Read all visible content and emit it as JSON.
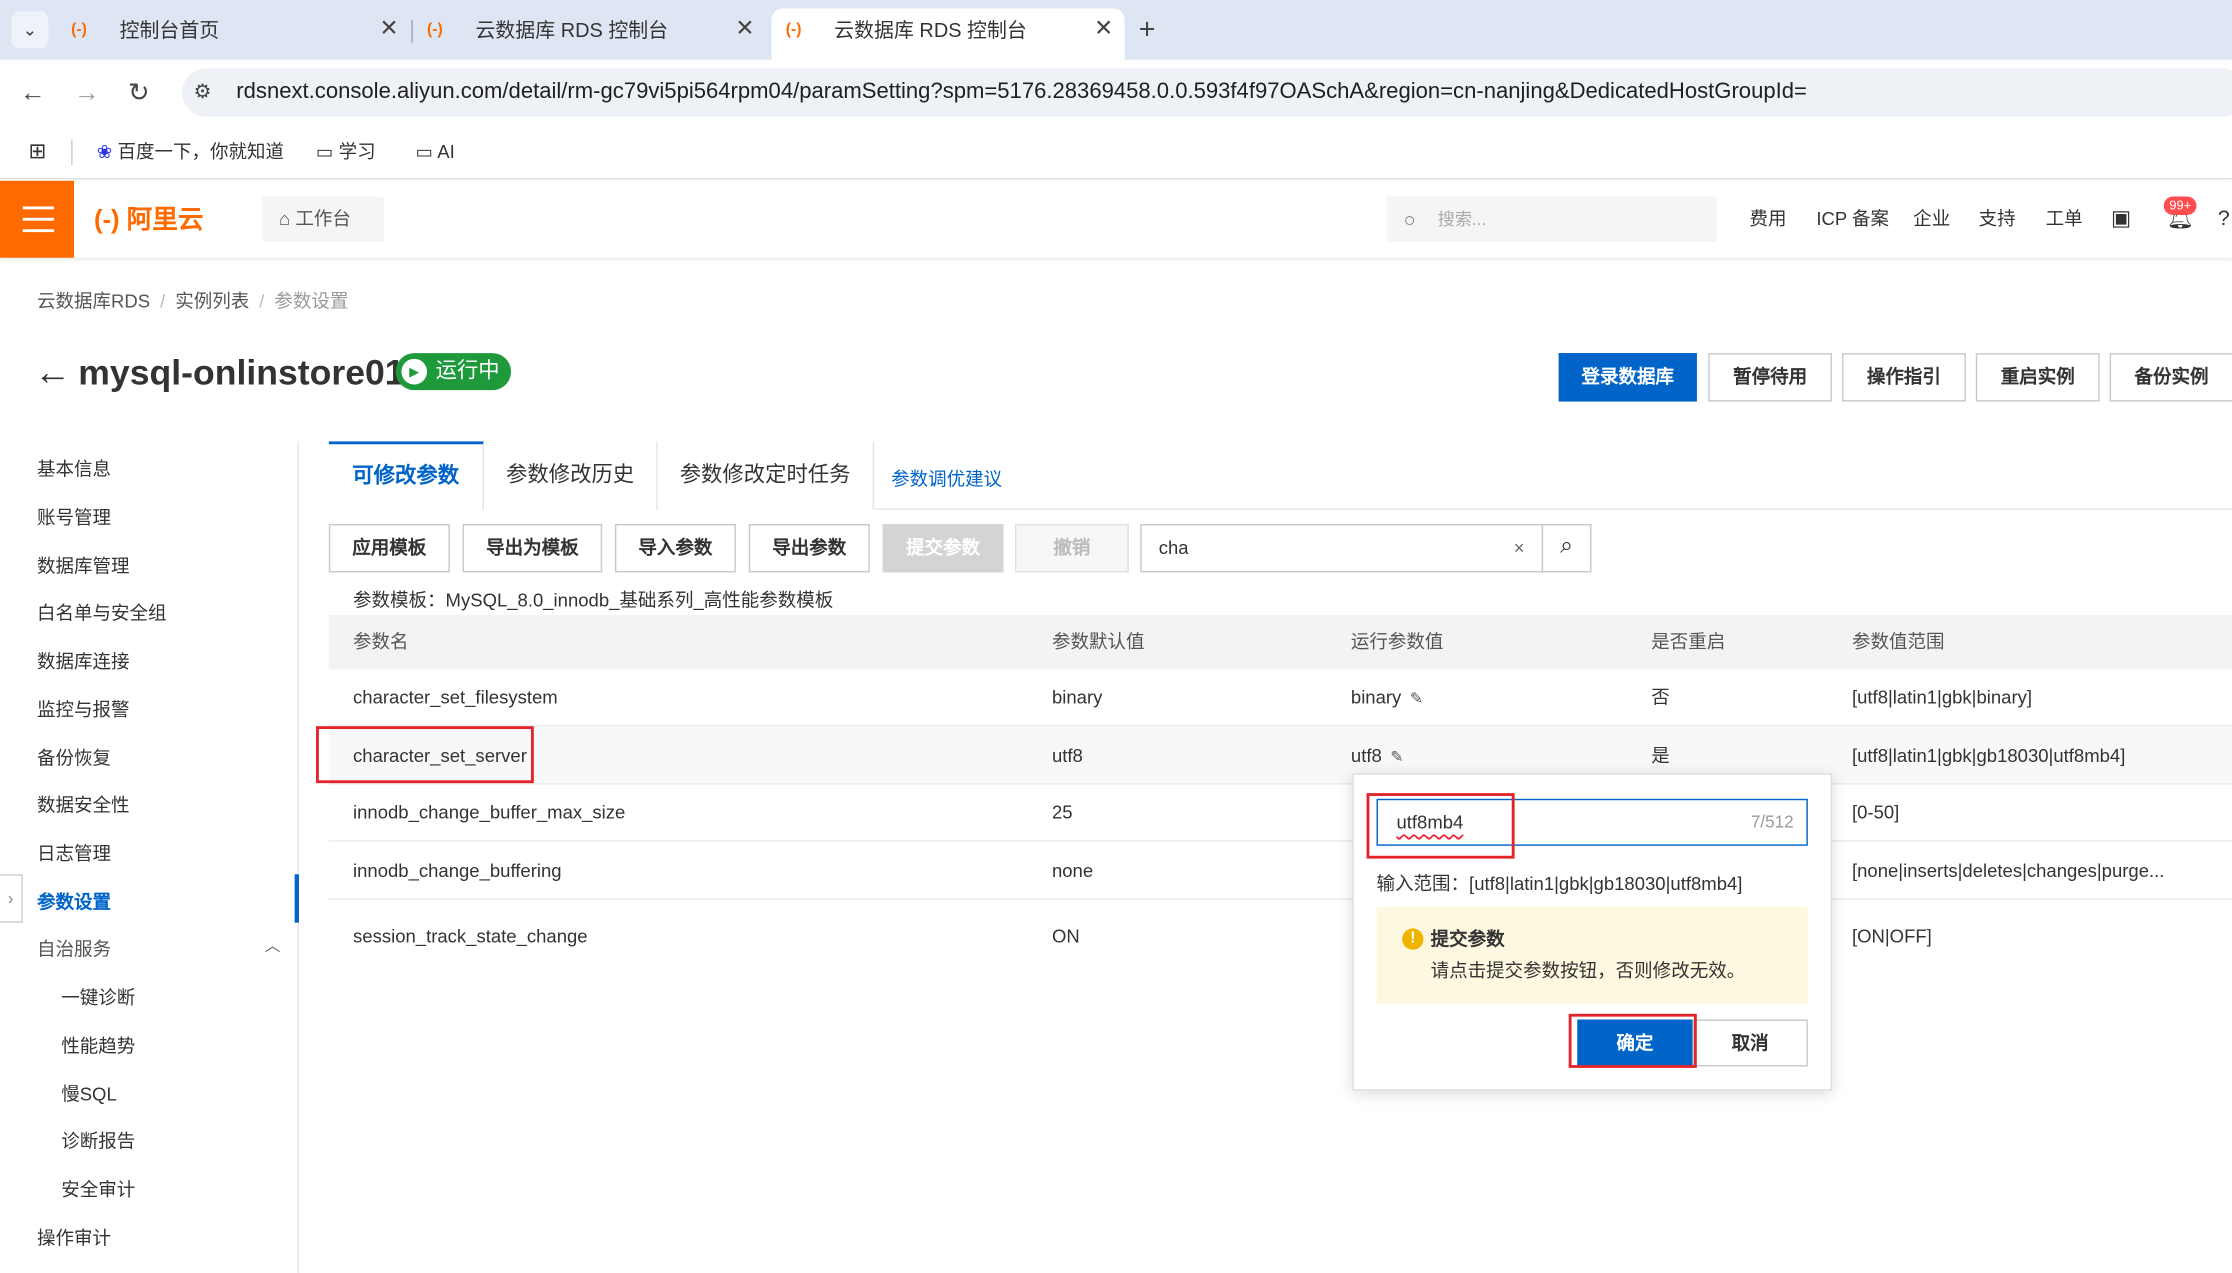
{
  "browser": {
    "tabs": [
      {
        "label": "控制台首页",
        "active": false
      },
      {
        "label": "云数据库 RDS 控制台",
        "active": false
      },
      {
        "label": "云数据库 RDS 控制台",
        "active": true
      }
    ],
    "url": "rdsnext.console.aliyun.com/detail/rm-gc79vi5pi564rpm04/paramSetting?spm=5176.28369458.0.0.593f4f97OASchA&region=cn-nanjing&DedicatedHostGroupId=",
    "bookmarks": [
      "百度一下，你就知道",
      "学习",
      "AI"
    ]
  },
  "header": {
    "logo": "(-) 阿里云",
    "workbench": "工作台",
    "search_placeholder": "搜索...",
    "nav": [
      "费用",
      "ICP 备案",
      "企业",
      "支持",
      "工单"
    ],
    "notification_badge": "99+",
    "accent_color": "#ff6a00"
  },
  "breadcrumb": [
    "云数据库RDS",
    "实例列表",
    "参数设置"
  ],
  "instance": {
    "name": "mysql-onlinstore01",
    "status": "运行中",
    "status_color": "#1f9a3a"
  },
  "actions": [
    "登录数据库",
    "暂停待用",
    "操作指引",
    "重启实例",
    "备份实例"
  ],
  "sidebar": {
    "items": [
      {
        "label": "基本信息"
      },
      {
        "label": "账号管理"
      },
      {
        "label": "数据库管理"
      },
      {
        "label": "白名单与安全组"
      },
      {
        "label": "数据库连接"
      },
      {
        "label": "监控与报警"
      },
      {
        "label": "备份恢复"
      },
      {
        "label": "数据安全性"
      },
      {
        "label": "日志管理"
      },
      {
        "label": "参数设置",
        "active": true
      },
      {
        "label": "自治服务"
      },
      {
        "label": "一键诊断",
        "sub": true
      },
      {
        "label": "性能趋势",
        "sub": true
      },
      {
        "label": "慢SQL",
        "sub": true
      },
      {
        "label": "诊断报告",
        "sub": true
      },
      {
        "label": "安全审计",
        "sub": true
      },
      {
        "label": "操作审计"
      }
    ]
  },
  "param_tabs": [
    "可修改参数",
    "参数修改历史",
    "参数修改定时任务"
  ],
  "param_tab_link": "参数调优建议",
  "toolbar": {
    "buttons": [
      "应用模板",
      "导出为模板",
      "导入参数",
      "导出参数",
      "提交参数",
      "撤销"
    ],
    "filter_value": "cha",
    "clear": "×"
  },
  "template_note": "参数模板：MySQL_8.0_innodb_基础系列_高性能参数模板",
  "table": {
    "columns": [
      "参数名",
      "参数默认值",
      "运行参数值",
      "是否重启",
      "参数值范围"
    ],
    "rows": [
      {
        "name": "character_set_filesystem",
        "default": "binary",
        "running": "binary",
        "restart": "否",
        "range": "[utf8|latin1|gbk|binary]"
      },
      {
        "name": "character_set_server",
        "default": "utf8",
        "running": "utf8",
        "restart": "是",
        "range": "[utf8|latin1|gbk|gb18030|utf8mb4]"
      },
      {
        "name": "innodb_change_buffer_max_size",
        "default": "25",
        "running": "",
        "restart": "",
        "range": "[0-50]"
      },
      {
        "name": "innodb_change_buffering",
        "default": "none",
        "running": "",
        "restart": "",
        "range": "[none|inserts|deletes|changes|purge..."
      },
      {
        "name": "session_track_state_change",
        "default": "ON",
        "running": "",
        "restart": "",
        "range": "[ON|OFF]"
      }
    ]
  },
  "popover": {
    "value": "utf8mb4",
    "count": "7/512",
    "range": "输入范围：[utf8|latin1|gbk|gb18030|utf8mb4]",
    "alert_title": "提交参数",
    "alert_msg": "请点击提交参数按钮，否则修改无效。",
    "ok": "确定",
    "cancel": "取消"
  }
}
